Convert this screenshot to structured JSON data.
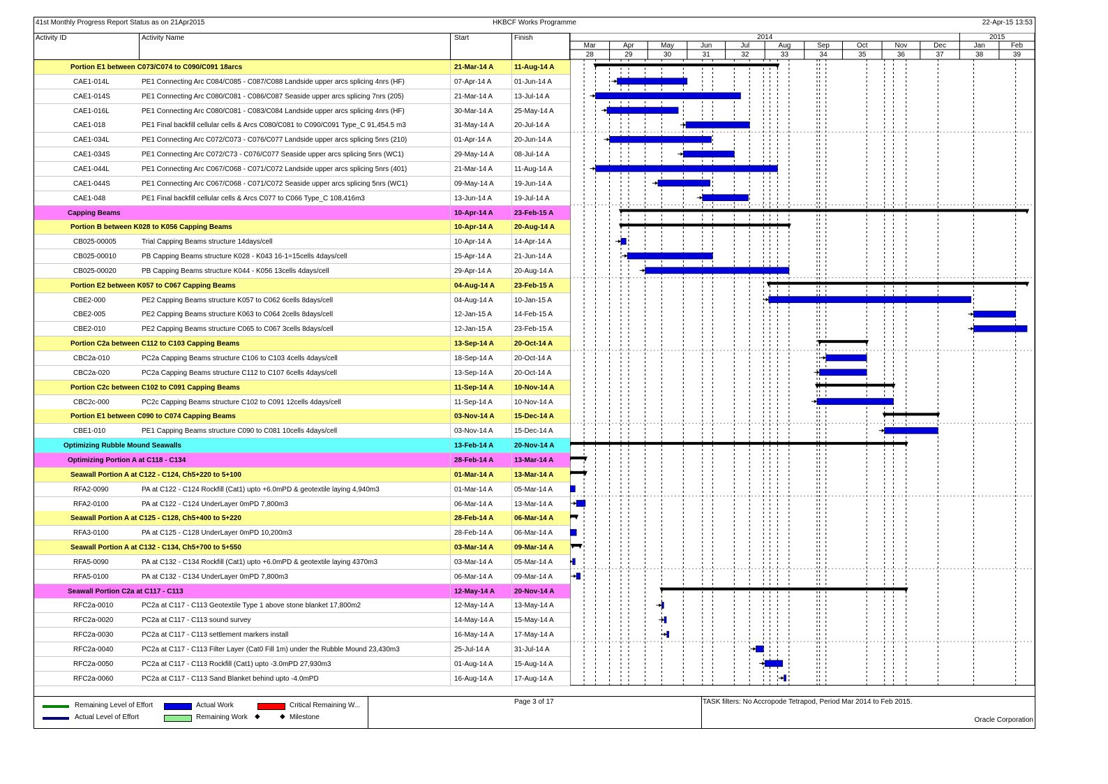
{
  "header": {
    "report_title": "41st Monthly Progress Report Status as on 21Apr2015",
    "programme_title": "HKBCF Works Programme",
    "report_date": "22-Apr-15 13:53"
  },
  "columns": {
    "activity_id": "Activity ID",
    "activity_name": "Activity Name",
    "start": "Start",
    "finish": "Finish"
  },
  "timescale": {
    "years": [
      {
        "label": "2014",
        "from": "2014-03-01",
        "to": "2015-01-01"
      },
      {
        "label": "2015",
        "from": "2015-01-01",
        "to": "2015-03-01"
      }
    ],
    "months": [
      "Mar",
      "Apr",
      "May",
      "Jun",
      "Jul",
      "Aug",
      "Sep",
      "Oct",
      "Nov",
      "Dec",
      "Jan",
      "Feb"
    ],
    "weeks": [
      "28",
      "29",
      "30",
      "31",
      "32",
      "33",
      "34",
      "35",
      "36",
      "37",
      "38",
      "39"
    ],
    "range": [
      "2014-03-01",
      "2015-03-01"
    ]
  },
  "colors": {
    "yellow_band": "#ffff99",
    "magenta_band": "#ff80ff",
    "cyan_band": "#66ffff",
    "actual_bar": "#0000dd",
    "summary_bar": "#000000"
  },
  "rows": [
    {
      "type": "group",
      "level": 3,
      "band": "yellow",
      "name": "Portion E1 between C073/C074 to C090/C091 18arcs",
      "start": "21-Mar-14 A",
      "finish": "11-Aug-14 A",
      "s": "2014-03-21",
      "f": "2014-08-11"
    },
    {
      "type": "activity",
      "id": "CAE1-014L",
      "name": "PE1 Connecting Arc C084/C085 - C087/C088 Landside upper arcs splicing 4nrs (HF)",
      "start": "07-Apr-14 A",
      "finish": "01-Jun-14 A",
      "s": "2014-04-07",
      "f": "2014-06-01"
    },
    {
      "type": "activity",
      "id": "CAE1-014S",
      "name": "PE1 Connecting Arc C080/C081 - C086/C087 Seaside upper arcs splicing 7nrs (205)",
      "start": "21-Mar-14 A",
      "finish": "13-Jul-14 A",
      "s": "2014-03-21",
      "f": "2014-07-13"
    },
    {
      "type": "activity",
      "id": "CAE1-016L",
      "name": "PE1 Connecting Arc C080/C081 - C083/C084 Landside upper arcs splicing 4nrs (HF)",
      "start": "30-Mar-14 A",
      "finish": "25-May-14 A",
      "s": "2014-03-30",
      "f": "2014-05-25"
    },
    {
      "type": "activity",
      "id": "CAE1-018",
      "name": "PE1 Final backfill cellular cells & Arcs C080/C081 to C090/C091 Type_C 91,454.5 m3",
      "start": "31-May-14 A",
      "finish": "20-Jul-14 A",
      "s": "2014-05-31",
      "f": "2014-07-20"
    },
    {
      "type": "activity",
      "id": "CAE1-034L",
      "name": "PE1 Connecting Arc C072/C073 - C076/C077 Landside upper arcs splicing 5nrs (210)",
      "start": "01-Apr-14 A",
      "finish": "20-Jun-14 A",
      "s": "2014-04-01",
      "f": "2014-06-20"
    },
    {
      "type": "activity",
      "id": "CAE1-034S",
      "name": "PE1 Connecting Arc C072/C73 - C076/C077 Seaside upper arcs splicing 5nrs (WC1)",
      "start": "29-May-14 A",
      "finish": "08-Jul-14 A",
      "s": "2014-05-29",
      "f": "2014-07-08"
    },
    {
      "type": "activity",
      "id": "CAE1-044L",
      "name": "PE1 Connecting Arc C067/C068 - C071/C072 Landside upper arcs splicing 5nrs (401)",
      "start": "21-Mar-14 A",
      "finish": "11-Aug-14 A",
      "s": "2014-03-21",
      "f": "2014-08-11"
    },
    {
      "type": "activity",
      "id": "CAE1-044S",
      "name": "PE1 Connecting Arc C067/C068 - C071/C072 Seaside upper arcs splicing 5nrs (WC1)",
      "start": "09-May-14 A",
      "finish": "19-Jun-14 A",
      "s": "2014-05-09",
      "f": "2014-06-19"
    },
    {
      "type": "activity",
      "id": "CAE1-048",
      "name": "PE1 Final backfill cellular cells & Arcs C077 to C066 Type_C 108,416m3",
      "start": "13-Jun-14 A",
      "finish": "19-Jul-14 A",
      "s": "2014-06-13",
      "f": "2014-07-19"
    },
    {
      "type": "group",
      "level": 2,
      "band": "magenta",
      "name": "Capping Beams",
      "start": "10-Apr-14 A",
      "finish": "23-Feb-15 A",
      "s": "2014-04-10",
      "f": "2015-02-23"
    },
    {
      "type": "group",
      "level": 3,
      "band": "yellow",
      "name": "Portion B between K028 to K056 Capping Beams",
      "start": "10-Apr-14 A",
      "finish": "20-Aug-14 A",
      "s": "2014-04-10",
      "f": "2014-08-20"
    },
    {
      "type": "activity",
      "id": "CB025-00005",
      "name": "Trial Capping Beams structure 14days/cell",
      "start": "10-Apr-14 A",
      "finish": "14-Apr-14 A",
      "s": "2014-04-10",
      "f": "2014-04-14"
    },
    {
      "type": "activity",
      "id": "CB025-00010",
      "name": "PB Capping Beams structure K028 - K043 16-1=15cells 4days/cell",
      "start": "15-Apr-14 A",
      "finish": "21-Jun-14 A",
      "s": "2014-04-15",
      "f": "2014-06-21"
    },
    {
      "type": "activity",
      "id": "CB025-00020",
      "name": "PB Capping Beams structure K044 - K056 13cells 4days/cell",
      "start": "29-Apr-14 A",
      "finish": "20-Aug-14 A",
      "s": "2014-04-29",
      "f": "2014-08-20"
    },
    {
      "type": "group",
      "level": 3,
      "band": "yellow",
      "name": "Portion E2 between K057 to C067 Capping Beams",
      "start": "04-Aug-14 A",
      "finish": "23-Feb-15 A",
      "s": "2014-08-04",
      "f": "2015-02-23"
    },
    {
      "type": "activity",
      "id": "CBE2-000",
      "name": "PE2 Capping Beams structure K057 to C062 6cells 8days/cell",
      "start": "04-Aug-14 A",
      "finish": "10-Jan-15 A",
      "s": "2014-08-04",
      "f": "2015-01-10"
    },
    {
      "type": "activity",
      "id": "CBE2-005",
      "name": "PE2 Capping Beams structure K063 to C064 2cells 8days/cell",
      "start": "12-Jan-15 A",
      "finish": "14-Feb-15 A",
      "s": "2015-01-12",
      "f": "2015-02-14"
    },
    {
      "type": "activity",
      "id": "CBE2-010",
      "name": "PE2 Capping Beams structure C065 to C067 3cells 8days/cell",
      "start": "12-Jan-15 A",
      "finish": "23-Feb-15 A",
      "s": "2015-01-12",
      "f": "2015-02-23"
    },
    {
      "type": "group",
      "level": 3,
      "band": "yellow",
      "name": "Portion C2a between C112 to C103 Capping Beams",
      "start": "13-Sep-14 A",
      "finish": "20-Oct-14 A",
      "s": "2014-09-13",
      "f": "2014-10-20"
    },
    {
      "type": "activity",
      "id": "CBC2a-010",
      "name": "PC2a Capping Beams structure C106 to C103 4cells 4days/cell",
      "start": "18-Sep-14 A",
      "finish": "20-Oct-14 A",
      "s": "2014-09-18",
      "f": "2014-10-20"
    },
    {
      "type": "activity",
      "id": "CBC2a-020",
      "name": "PC2a Capping Beams structure C112 to C107 6cells 4days/cell",
      "start": "13-Sep-14 A",
      "finish": "20-Oct-14 A",
      "s": "2014-09-13",
      "f": "2014-10-20"
    },
    {
      "type": "group",
      "level": 3,
      "band": "yellow",
      "name": "Portion C2c between C102 to C091 Capping Beams",
      "start": "11-Sep-14 A",
      "finish": "10-Nov-14 A",
      "s": "2014-09-11",
      "f": "2014-11-10"
    },
    {
      "type": "activity",
      "id": "CBC2c-000",
      "name": "PC2c Capping Beams structure C102 to C091 12cells 4days/cell",
      "start": "11-Sep-14 A",
      "finish": "10-Nov-14 A",
      "s": "2014-09-11",
      "f": "2014-11-10"
    },
    {
      "type": "group",
      "level": 3,
      "band": "yellow",
      "name": "Portion E1 between C090 to C074 Capping Beams",
      "start": "03-Nov-14 A",
      "finish": "15-Dec-14 A",
      "s": "2014-11-03",
      "f": "2014-12-15"
    },
    {
      "type": "activity",
      "id": "CBE1-010",
      "name": "PE1 Capping Beams structure C090 to C081 10cells 4days/cell",
      "start": "03-Nov-14 A",
      "finish": "15-Dec-14 A",
      "s": "2014-11-03",
      "f": "2014-12-15"
    },
    {
      "type": "group",
      "level": 1,
      "band": "cyan",
      "name": "Optimizing Rubble Mound Seawalls",
      "start": "13-Feb-14 A",
      "finish": "20-Nov-14 A",
      "s": "2014-02-13",
      "f": "2014-11-20"
    },
    {
      "type": "group",
      "level": 2,
      "band": "magenta",
      "name": "Optimizing Portion A at C118 - C134",
      "start": "28-Feb-14 A",
      "finish": "13-Mar-14 A",
      "s": "2014-02-28",
      "f": "2014-03-13"
    },
    {
      "type": "group",
      "level": 3,
      "band": "yellow",
      "name": "Seawall Portion A at C122 - C124, Ch5+220 to 5+100",
      "start": "01-Mar-14 A",
      "finish": "13-Mar-14 A",
      "s": "2014-03-01",
      "f": "2014-03-13"
    },
    {
      "type": "activity",
      "id": "RFA2-0090",
      "name": "PA at C122 - C124 Rockfill (Cat1) upto +6.0mPD & geotextile laying 4,940m3",
      "start": "01-Mar-14 A",
      "finish": "05-Mar-14 A",
      "s": "2014-03-01",
      "f": "2014-03-05"
    },
    {
      "type": "activity",
      "id": "RFA2-0100",
      "name": "PA at C122 - C124 UnderLayer 0mPD 7,800m3",
      "start": "06-Mar-14 A",
      "finish": "13-Mar-14 A",
      "s": "2014-03-06",
      "f": "2014-03-13"
    },
    {
      "type": "group",
      "level": 3,
      "band": "yellow",
      "name": "Seawall Portion A at C125 - C128, Ch5+400 to 5+220",
      "start": "28-Feb-14 A",
      "finish": "06-Mar-14 A",
      "s": "2014-02-28",
      "f": "2014-03-06"
    },
    {
      "type": "activity",
      "id": "RFA3-0100",
      "name": "PA at C125 - C128 UnderLayer 0mPD 10,200m3",
      "start": "28-Feb-14 A",
      "finish": "06-Mar-14 A",
      "s": "2014-02-28",
      "f": "2014-03-06"
    },
    {
      "type": "group",
      "level": 3,
      "band": "yellow",
      "name": "Seawall Portion A at C132 - C134, Ch5+700 to 5+550",
      "start": "03-Mar-14 A",
      "finish": "09-Mar-14 A",
      "s": "2014-03-03",
      "f": "2014-03-09"
    },
    {
      "type": "activity",
      "id": "RFA5-0090",
      "name": "PA at C132 - C134 Rockfill (Cat1) upto +6.0mPD & geotextile laying 4370m3",
      "start": "03-Mar-14 A",
      "finish": "05-Mar-14 A",
      "s": "2014-03-03",
      "f": "2014-03-05"
    },
    {
      "type": "activity",
      "id": "RFA5-0100",
      "name": "PA at C132 - C134 UnderLayer 0mPD 7,800m3",
      "start": "06-Mar-14 A",
      "finish": "09-Mar-14 A",
      "s": "2014-03-06",
      "f": "2014-03-09"
    },
    {
      "type": "group",
      "level": 2,
      "band": "magenta",
      "name": "Seawall Portion C2a at C117 - C113",
      "start": "12-May-14 A",
      "finish": "20-Nov-14 A",
      "s": "2014-05-12",
      "f": "2014-11-20"
    },
    {
      "type": "activity",
      "id": "RFC2a-0010",
      "name": "PC2a at C117 - C113 Geotextile Type 1 above stone blanket 17,800m2",
      "start": "12-May-14 A",
      "finish": "13-May-14 A",
      "s": "2014-05-12",
      "f": "2014-05-13"
    },
    {
      "type": "activity",
      "id": "RFC2a-0020",
      "name": "PC2a at C117 - C113 sound survey",
      "start": "14-May-14 A",
      "finish": "15-May-14 A",
      "s": "2014-05-14",
      "f": "2014-05-15"
    },
    {
      "type": "activity",
      "id": "RFC2a-0030",
      "name": "PC2a at C117 - C113 settlement markers install",
      "start": "16-May-14 A",
      "finish": "17-May-14 A",
      "s": "2014-05-16",
      "f": "2014-05-17"
    },
    {
      "type": "activity",
      "id": "RFC2a-0040",
      "name": "PC2a at C117 - C113 Filter Layer (Cat0 Fill 1m) under the Rubble Mound 23,430m3",
      "start": "25-Jul-14 A",
      "finish": "31-Jul-14 A",
      "s": "2014-07-25",
      "f": "2014-07-31"
    },
    {
      "type": "activity",
      "id": "RFC2a-0050",
      "name": "PC2a at C117 - C113 Rockfill (Cat1) upto -3.0mPD 27,930m3",
      "start": "01-Aug-14 A",
      "finish": "15-Aug-14 A",
      "s": "2014-08-01",
      "f": "2014-08-15"
    },
    {
      "type": "activity",
      "id": "RFC2a-0060",
      "name": "PC2a at C117 - C113 Sand Blanket behind upto -4.0mPD",
      "start": "16-Aug-14 A",
      "finish": "17-Aug-14 A",
      "s": "2014-08-16",
      "f": "2014-08-17"
    }
  ],
  "legend": {
    "items": [
      {
        "label": "Remaining Level of Effort",
        "color": "#008000",
        "kind": "line"
      },
      {
        "label": "Actual Level of Effort",
        "color": "#000080",
        "kind": "line"
      },
      {
        "label": "Actual Work",
        "color": "#0000dd",
        "kind": "box"
      },
      {
        "label": "Remaining Work",
        "color": "#90ee90",
        "kind": "box"
      },
      {
        "label": "Critical Remaining W...",
        "color": "#ff0000",
        "kind": "box"
      },
      {
        "label": "Milestone",
        "color": "#000000",
        "kind": "diamond"
      }
    ],
    "page": "Page 3 of 17",
    "filters": "TASK filters: No Accropode Tetrapod, Period Mar 2014 to Feb 2015.",
    "company": "Oracle Corporation"
  }
}
